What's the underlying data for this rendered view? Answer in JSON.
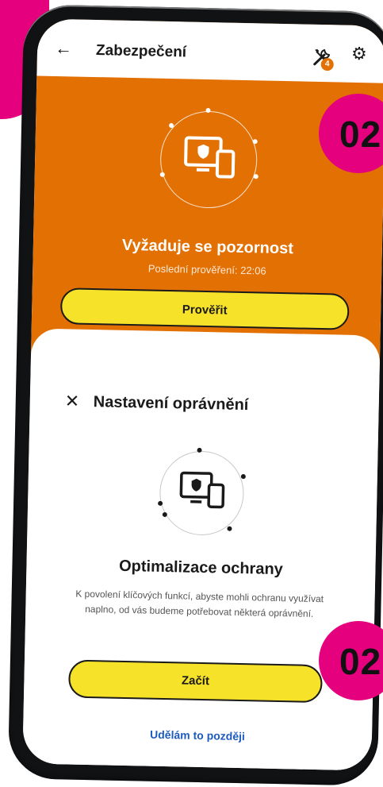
{
  "colors": {
    "accent_orange": "#e37003",
    "button_yellow": "#f7e22a",
    "brand_magenta": "#e5007e",
    "link_blue": "#1e5bbf"
  },
  "appbar": {
    "back_icon": "arrow-left-icon",
    "title": "Zabezpečení",
    "tools_icon": "wrench-screwdriver-icon",
    "tools_badge": "4",
    "settings_icon": "gear-icon"
  },
  "status": {
    "heading": "Vyžaduje se pozornost",
    "last_check": "Poslední prověření: 22:06",
    "check_button": "Prověřit"
  },
  "sheet": {
    "close_icon": "close-icon",
    "title": "Nastavení oprávnění",
    "heading": "Optimalizace ochrany",
    "description": "K povolení klíčových funkcí, abyste mohli ochranu využívat naplno, od vás budeme potřebovat některá oprávnění.",
    "start_button": "Začít",
    "later_link": "Udělám to později"
  },
  "overlay": {
    "marker_top": "02",
    "marker_bottom": "02"
  }
}
